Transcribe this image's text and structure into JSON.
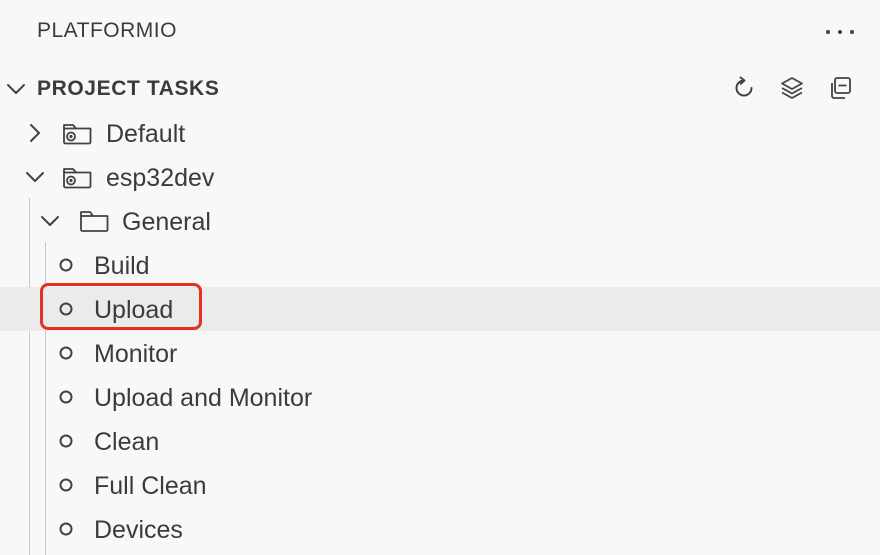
{
  "panel": {
    "title": "PLATFORMIO"
  },
  "section": {
    "title": "PROJECT TASKS",
    "actions": [
      "refresh-icon",
      "layers-icon",
      "collapse-all-icon"
    ]
  },
  "tree": {
    "default_env": {
      "label": "Default",
      "expanded": false
    },
    "esp32dev_env": {
      "label": "esp32dev",
      "expanded": true
    },
    "general_folder": {
      "label": "General",
      "expanded": true
    },
    "tasks": [
      {
        "label": "Build"
      },
      {
        "label": "Upload",
        "selected": true
      },
      {
        "label": "Monitor"
      },
      {
        "label": "Upload and Monitor"
      },
      {
        "label": "Clean"
      },
      {
        "label": "Full Clean"
      },
      {
        "label": "Devices"
      }
    ]
  },
  "colors": {
    "background": "#f8f8f8",
    "selected_row": "#ebebeb",
    "highlight_border": "#e5321f",
    "text": "#3b3b3b"
  }
}
